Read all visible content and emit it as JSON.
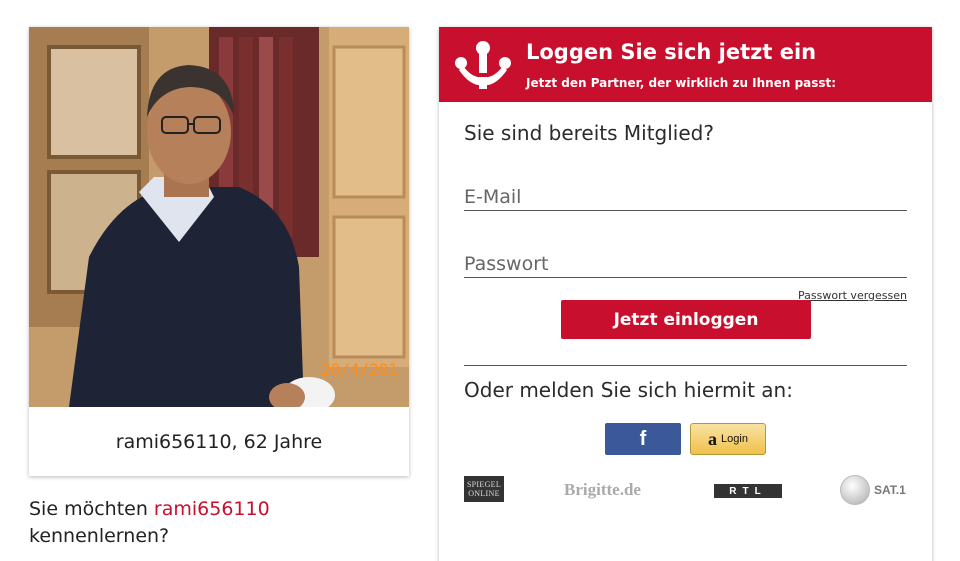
{
  "profile": {
    "name_age": "rami656110, 62 Jahre",
    "photo_date_stamp": "20/4/201"
  },
  "intro": {
    "prefix": "Sie möchten ",
    "username": "rami656110",
    "suffix": "kennenlernen?"
  },
  "login": {
    "title": "Loggen Sie sich jetzt ein",
    "subtitle": "Jetzt den Partner, der wirklich zu Ihnen passt:",
    "member_question": "Sie sind bereits Mitglied?",
    "email_placeholder": "E-Mail",
    "password_placeholder": "Passwort",
    "forgot_password": "Passwort vergessen",
    "submit_label": "Jetzt einloggen",
    "alt_question": "Oder melden Sie sich hiermit an:",
    "facebook_label": "f",
    "amazon_label": "Login",
    "amazon_icon": "a"
  },
  "press": {
    "spiegel_line1": "SPIEGEL",
    "spiegel_line2": "ONLINE",
    "brigitte": "Brigitte.de",
    "rtl": "RTL",
    "sat1": "SAT.1"
  },
  "colors": {
    "brand_red": "#c8102e",
    "facebook_blue": "#3b5998",
    "amazon_yellow": "#f0c14b"
  }
}
